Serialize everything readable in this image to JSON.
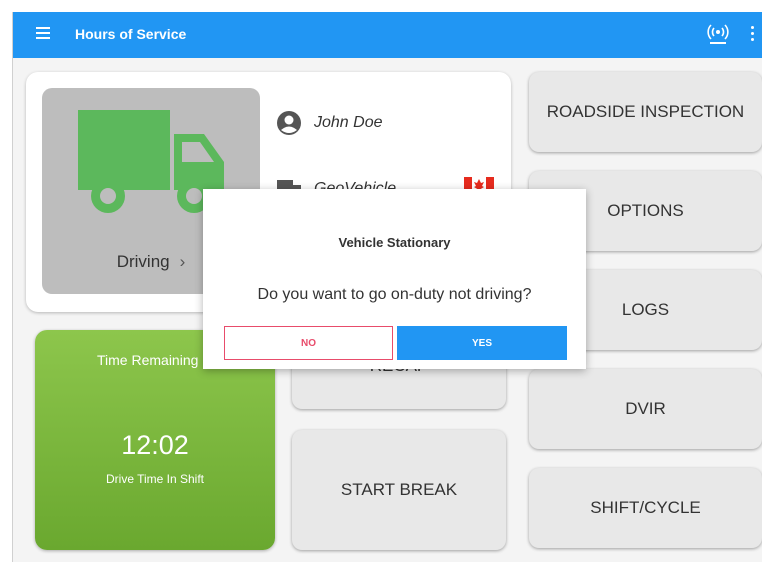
{
  "app": {
    "title": "Hours of Service"
  },
  "status": {
    "duty_label": "Driving",
    "driver_name": "John Doe",
    "vehicle_name": "GeoVehicle"
  },
  "time_card": {
    "title": "Time Remaining",
    "value": "12:02",
    "subtitle": "Drive Time In Shift"
  },
  "actions": {
    "roadside": "ROADSIDE INSPECTION",
    "options": "OPTIONS",
    "logs": "LOGS",
    "dvir": "DVIR",
    "shift_cycle": "SHIFT/CYCLE",
    "recap": "RECAP",
    "start_break": "START BREAK"
  },
  "dialog": {
    "title": "Vehicle Stationary",
    "message": "Do you want to go on-duty not driving?",
    "no_label": "NO",
    "yes_label": "YES"
  },
  "colors": {
    "appbar": "#2196f3",
    "duty_tile": "#bdbdbd",
    "truck": "#5cb85c",
    "time_card": "#7ab63e",
    "no_button": "#e84c6b",
    "yes_button": "#2196f3"
  }
}
